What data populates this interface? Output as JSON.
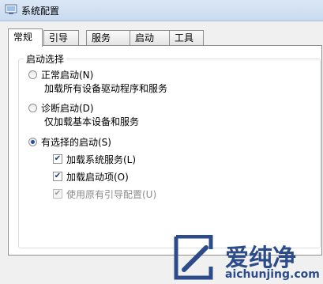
{
  "window": {
    "title": "系统配置",
    "icon": "system-config-icon"
  },
  "tabs": [
    {
      "label": "常规",
      "active": true
    },
    {
      "label": "引导",
      "active": false
    },
    {
      "label": "服务",
      "active": false
    },
    {
      "label": "启动",
      "active": false
    },
    {
      "label": "工具",
      "active": false
    }
  ],
  "startup_group": {
    "title": "启动选择",
    "options": [
      {
        "label": "正常启动(N)",
        "description": "加载所有设备驱动程序和服务",
        "selected": false
      },
      {
        "label": "诊断启动(D)",
        "description": "仅加载基本设备和服务",
        "selected": false
      },
      {
        "label": "有选择的启动(S)",
        "selected": true
      }
    ],
    "checkboxes": [
      {
        "label": "加载系统服务(L)",
        "checked": true,
        "enabled": true
      },
      {
        "label": "加载启动项(O)",
        "checked": true,
        "enabled": true
      },
      {
        "label": "使用原有引导配置(U)",
        "checked": true,
        "enabled": false
      }
    ]
  },
  "watermark": {
    "text": "爱纯净",
    "url": "aichunjing.com",
    "logo": "aichunjing-logo-icon",
    "color": "#2c4b8a"
  }
}
